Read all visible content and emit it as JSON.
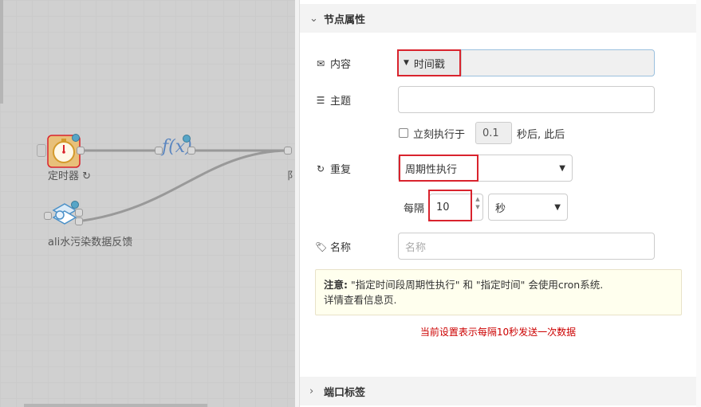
{
  "canvas": {
    "nodes": [
      {
        "label": "定时器 ↻",
        "icon": "stopwatch-icon"
      },
      {
        "label": "f(x)",
        "icon": "function-icon"
      },
      {
        "label": "ali水污染数据反馈",
        "icon": "cloud-data-icon"
      },
      {
        "label": "阝",
        "icon": "partial-node"
      }
    ]
  },
  "panel": {
    "node_props_header": "节点属性",
    "payload": {
      "label": "内容",
      "type_value": "时间戳",
      "icon": "envelope-icon"
    },
    "topic": {
      "label": "主题",
      "value": "",
      "icon": "tasks-icon"
    },
    "once": {
      "label": "立刻执行于",
      "delay": "0.1",
      "suffix": "秒后, 此后"
    },
    "repeat": {
      "label": "重复",
      "icon": "refresh-icon",
      "mode": "周期性执行"
    },
    "interval": {
      "label": "每隔",
      "value": "10",
      "unit": "秒"
    },
    "name": {
      "label": "名称",
      "placeholder": "名称",
      "icon": "tag-icon"
    },
    "tip": {
      "bold": "注意:",
      "line1": " \"指定时间段周期性执行\" 和 \"指定时间\" 会使用cron系统.",
      "line2": "详情查看信息页."
    },
    "annotation": "当前设置表示每隔10秒发送一次数据",
    "port_labels_header": "端口标签"
  },
  "colors": {
    "highlight_red": "#d9232d",
    "status_blue": "#57a5c7",
    "tip_bg": "#ffffee"
  }
}
